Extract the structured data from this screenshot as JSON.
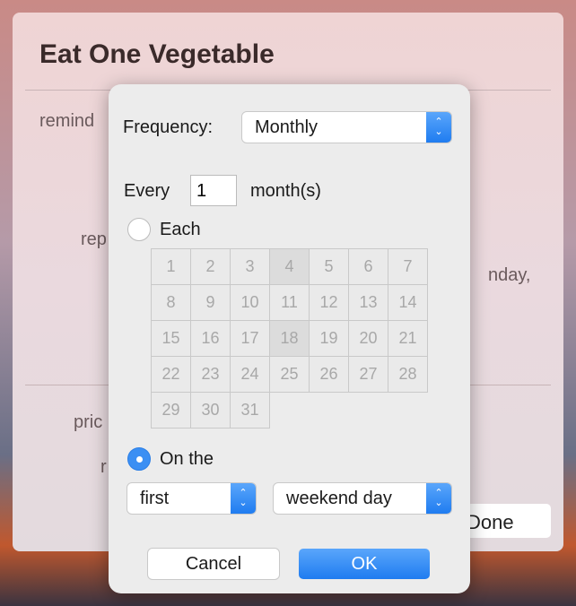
{
  "background": {
    "title": "Eat One Vegetable",
    "fragments": [
      "remind",
      "rep",
      "nday,",
      "pric",
      "r"
    ],
    "done_label": "Done"
  },
  "dialog": {
    "frequency_label": "Frequency:",
    "frequency_value": "Monthly",
    "every_label": "Every",
    "every_value": "1",
    "unit_label": "month(s)",
    "each_label": "Each",
    "each_selected": false,
    "days": [
      "1",
      "2",
      "3",
      "4",
      "5",
      "6",
      "7",
      "8",
      "9",
      "10",
      "11",
      "12",
      "13",
      "14",
      "15",
      "16",
      "17",
      "18",
      "19",
      "20",
      "21",
      "22",
      "23",
      "24",
      "25",
      "26",
      "27",
      "28",
      "29",
      "30",
      "31"
    ],
    "highlighted_days": [
      "4",
      "18"
    ],
    "on_the_label": "On the",
    "on_the_selected": true,
    "ordinal_value": "first",
    "day_type_value": "weekend day",
    "cancel_label": "Cancel",
    "ok_label": "OK"
  },
  "colors": {
    "accent": "#3b8ff3"
  }
}
